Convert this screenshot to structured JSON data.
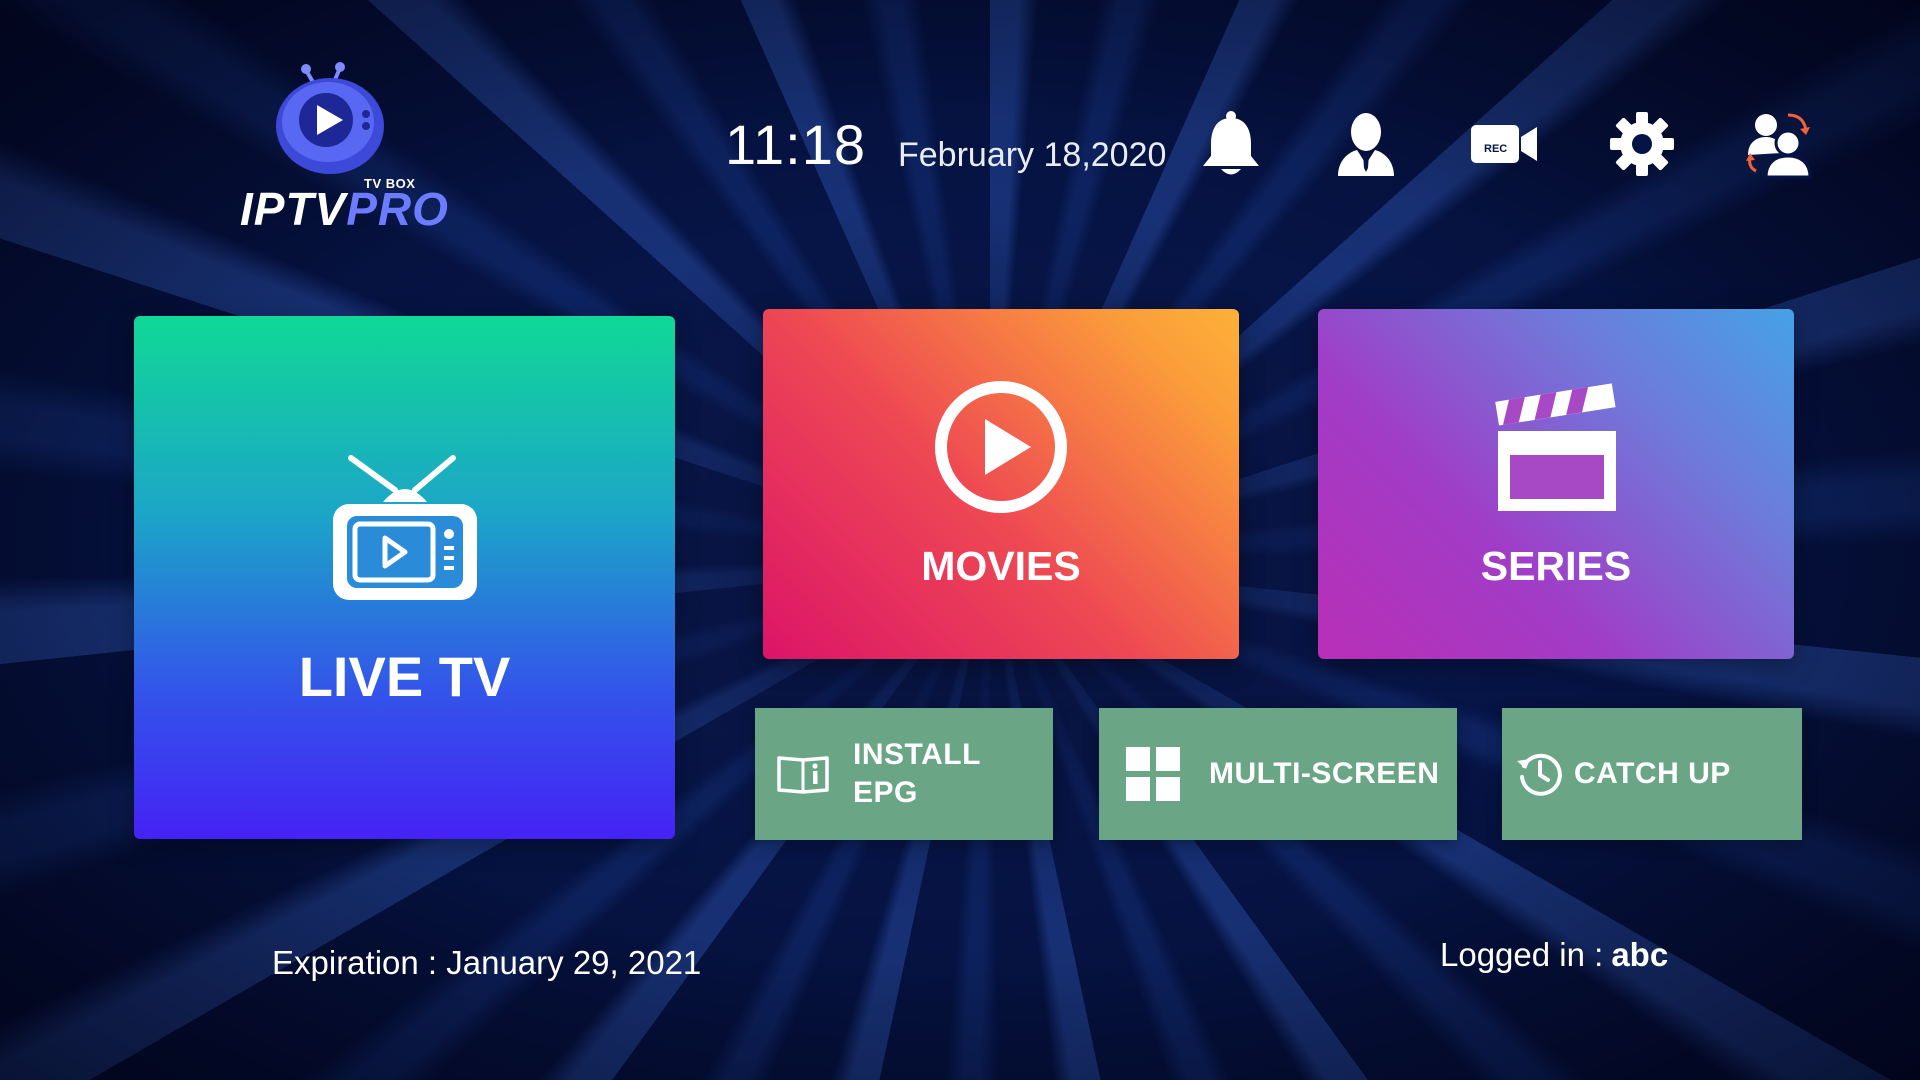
{
  "logo": {
    "sub": "TV BOX",
    "name_main": "IPTV",
    "name_accent": "PRO"
  },
  "header": {
    "time": "11:18",
    "date": "February 18,2020",
    "icons": {
      "notifications": "bell-icon",
      "account": "user-icon",
      "record": "rec-camera-icon",
      "record_badge": "REC",
      "settings": "gear-icon",
      "switch_user": "switch-user-icon"
    }
  },
  "tiles": {
    "live_tv": "LIVE TV",
    "movies": "MOVIES",
    "series": "SERIES"
  },
  "buttons": {
    "install_epg_line1": "INSTALL",
    "install_epg_line2": "EPG",
    "multi_screen": "MULTI-SCREEN",
    "catch_up": "CATCH UP"
  },
  "footer": {
    "expiration": "Expiration : January 29, 2021",
    "logged_in_label": "Logged in :",
    "logged_in_user": "abc"
  },
  "colors": {
    "tile_button": "#6aa685",
    "logo_accent": "#6d7bff",
    "background": "#061445"
  }
}
